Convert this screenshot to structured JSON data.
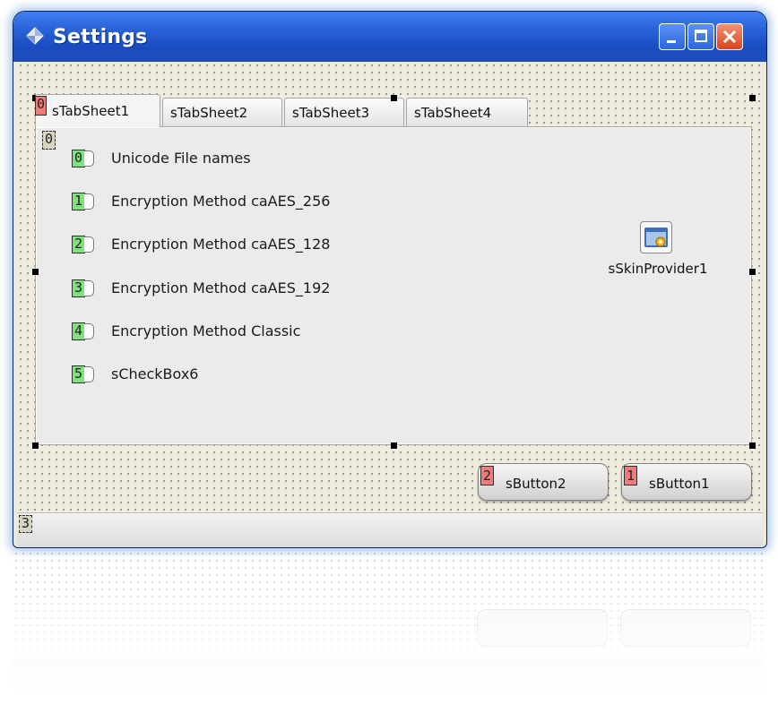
{
  "window": {
    "title": "Settings",
    "title_bar_color": "#2a63d8"
  },
  "tabs": [
    {
      "label": "sTabSheet1",
      "active": true
    },
    {
      "label": "sTabSheet2",
      "active": false
    },
    {
      "label": "sTabSheet3",
      "active": false
    },
    {
      "label": "sTabSheet4",
      "active": false
    }
  ],
  "tab_order_badges": {
    "page_control": "0",
    "tab_panel": "0",
    "status_bar": "3"
  },
  "checkboxes": [
    {
      "badge": "0",
      "label": "Unicode File names"
    },
    {
      "badge": "1",
      "label": "Encryption Method  caAES_256"
    },
    {
      "badge": "2",
      "label": "Encryption Method  caAES_128"
    },
    {
      "badge": "3",
      "label": "Encryption Method  caAES_192"
    },
    {
      "badge": "4",
      "label": "Encryption Method  Classic"
    },
    {
      "badge": "5",
      "label": "sCheckBox6"
    }
  ],
  "components": {
    "skin_provider": {
      "label": "sSkinProvider1",
      "icon": "skin-provider-icon"
    }
  },
  "buttons": {
    "button2": {
      "badge": "2",
      "label": "sButton2"
    },
    "button1": {
      "badge": "1",
      "label": "sButton1"
    }
  },
  "colors": {
    "badge_red": "#ef7b7b",
    "badge_green": "#7fe07f",
    "form_background": "#efecdd"
  }
}
